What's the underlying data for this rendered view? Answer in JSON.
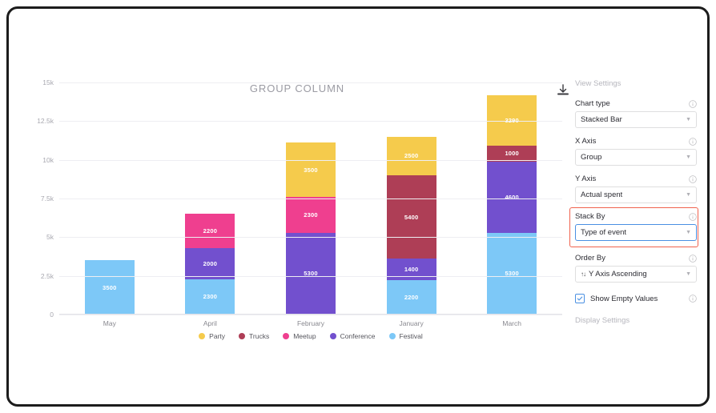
{
  "chart_data": {
    "type": "bar",
    "subtype": "stacked",
    "title": "GROUP COLUMN",
    "xlabel": "",
    "ylabel": "",
    "ylim": [
      0,
      15000
    ],
    "ytick_labels": [
      "0",
      "2.5k",
      "5k",
      "7.5k",
      "10k",
      "12.5k",
      "15k"
    ],
    "ytick_values": [
      0,
      2500,
      5000,
      7500,
      10000,
      12500,
      15000
    ],
    "grid": true,
    "legend_position": "bottom",
    "categories": [
      "May",
      "April",
      "February",
      "January",
      "March"
    ],
    "series": [
      {
        "name": "Party",
        "color": "#f5cb4c",
        "values": [
          0,
          0,
          3500,
          2500,
          3290
        ]
      },
      {
        "name": "Trucks",
        "color": "#ae3e56",
        "values": [
          0,
          0,
          0,
          5400,
          1000
        ]
      },
      {
        "name": "Meetup",
        "color": "#ef3f8f",
        "values": [
          0,
          2200,
          2300,
          0,
          0
        ]
      },
      {
        "name": "Conference",
        "color": "#7250ce",
        "values": [
          0,
          2000,
          5300,
          1400,
          4600
        ]
      },
      {
        "name": "Festival",
        "color": "#7dc8f7",
        "values": [
          3500,
          2300,
          0,
          2200,
          5300
        ]
      }
    ],
    "stack_order_bottom_to_top": [
      "Festival",
      "Conference",
      "Meetup",
      "Trucks",
      "Party"
    ],
    "totals": [
      3500,
      6500,
      11100,
      11500,
      14190
    ]
  },
  "chart": {
    "title": "GROUP COLUMN",
    "download_icon": "download-icon"
  },
  "settings": {
    "header": "View Settings",
    "fields": [
      {
        "label": "Chart type",
        "value": "Stacked Bar",
        "icon": "info-icon"
      },
      {
        "label": "X Axis",
        "value": "Group",
        "icon": "info-icon"
      },
      {
        "label": "Y Axis",
        "value": "Actual spent",
        "icon": "info-icon"
      },
      {
        "label": "Stack By",
        "value": "Type of event",
        "icon": "info-icon"
      },
      {
        "label": "Order By",
        "value": "Y Axis Ascending",
        "icon": "info-icon",
        "prefix": "↑↓"
      }
    ],
    "show_empty_values": {
      "label": "Show Empty Values",
      "checked": true
    },
    "display_settings": "Display Settings",
    "highlight_color": "#f0624d",
    "focus_color": "#4a90e2"
  }
}
